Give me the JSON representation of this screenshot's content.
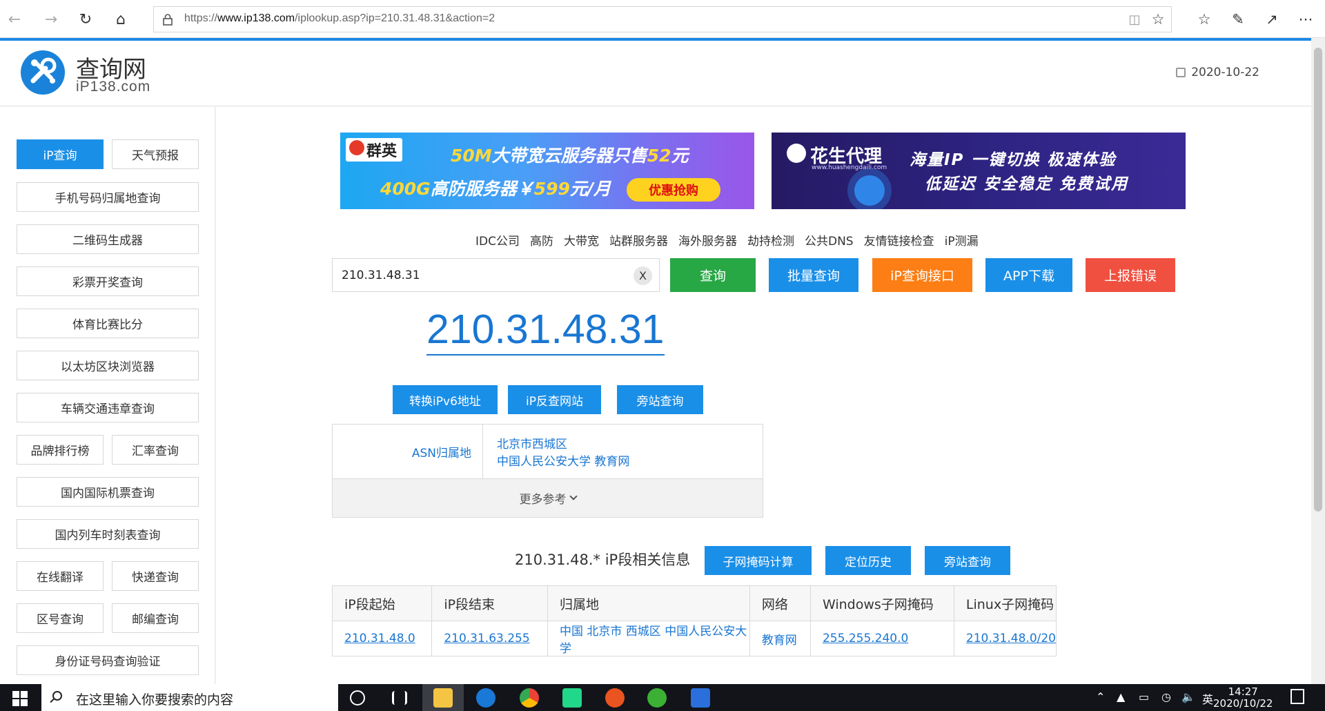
{
  "browser": {
    "url_prefix": "https://",
    "url_domain": "www.ip138.com",
    "url_path": "/iplookup.asp?ip=210.31.48.31&action=2",
    "icons": [
      "back-icon",
      "forward-icon",
      "refresh-icon",
      "home-icon",
      "lock-icon",
      "reading-view-icon",
      "favorite-star-icon",
      "favorites-icon",
      "pen-icon",
      "share-icon",
      "more-icon"
    ]
  },
  "header": {
    "logo_title": "查询网",
    "logo_sub": "iP138.com",
    "date": "2020-10-22"
  },
  "sidebar": {
    "items": [
      "iP查询",
      "天气预报",
      "手机号码归属地查询",
      "二维码生成器",
      "彩票开奖查询",
      "体育比赛比分",
      "以太坊区块浏览器",
      "车辆交通违章查询",
      "品牌排行榜",
      "汇率查询",
      "国内国际机票查询",
      "国内列车时刻表查询",
      "在线翻译",
      "快递查询",
      "区号查询",
      "邮编查询",
      "身份证号码查询验证"
    ]
  },
  "banners": {
    "b1_logo": "群英",
    "b1_line1_a": "50M",
    "b1_line1_b": "大带宽云服务器只售",
    "b1_line1_c": "52",
    "b1_line1_d": "元",
    "b1_line2_a": "400G",
    "b1_line2_b": "高防服务器￥",
    "b1_line2_c": "599",
    "b1_line2_d": "元/月",
    "b1_btn": "优惠抢购",
    "b2_logo": "花生代理",
    "b2_domain": "www.huashengdaili.com",
    "b2_line1": "海量IP  一键切换  极速体验",
    "b2_line2": "低延迟  安全稳定  免费试用"
  },
  "links": [
    "IDC公司",
    "高防",
    "大带宽",
    "站群服务器",
    "海外服务器",
    "劫持检测",
    "公共DNS",
    "友情链接检查",
    "iP测漏"
  ],
  "search": {
    "value": "210.31.48.31",
    "clear": "X",
    "query_btn": "查询",
    "batch_btn": "批量查询",
    "api_btn": "iP查询接口",
    "app_btn": "APP下载",
    "report_btn": "上报错误"
  },
  "result": {
    "ip": "210.31.48.31",
    "ipv6_btn": "转换iPv6地址",
    "reverse_btn": "iP反查网站",
    "side_btn": "旁站查询",
    "asn_label": "ASN归属地",
    "asn_line1": "北京市西城区",
    "asn_line2": "中国人民公安大学 教育网",
    "more": "更多参考"
  },
  "segment": {
    "title": "210.31.48.* iP段相关信息",
    "subnet_btn": "子网掩码计算",
    "history_btn": "定位历史",
    "side_btn": "旁站查询",
    "headers": [
      "iP段起始",
      "iP段结束",
      "归属地",
      "网络",
      "Windows子网掩码",
      "Linux子网掩码"
    ],
    "row": [
      "210.31.48.0",
      "210.31.63.255",
      "中国 北京市 西城区 中国人民公安大学",
      "教育网",
      "255.255.240.0",
      "210.31.48.0/20"
    ]
  },
  "taskbar": {
    "search_placeholder": "在这里输入你要搜索的内容",
    "tray_lang": "英",
    "time": "14:27",
    "date": "2020/10/22"
  },
  "colors": {
    "accent": "#1a8fe8",
    "green": "#28a745",
    "orange": "#fd7e14",
    "red": "#f0503f",
    "link": "#1976d2"
  }
}
